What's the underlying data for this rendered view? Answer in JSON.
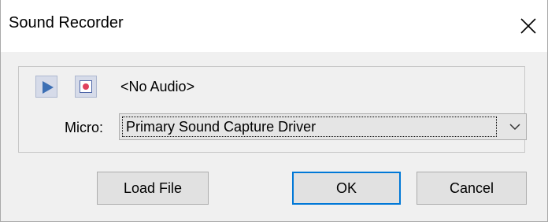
{
  "window": {
    "title": "Sound Recorder",
    "close_icon": "close-icon"
  },
  "recorder": {
    "play_icon": "play-icon",
    "record_icon": "record-icon",
    "status": "<No Audio>",
    "micro_label": "Micro:",
    "micro_selected": "Primary Sound Capture Driver",
    "dropdown_icon": "chevron-down-icon"
  },
  "buttons": {
    "load_file": "Load File",
    "ok": "OK",
    "cancel": "Cancel"
  },
  "colors": {
    "accent": "#0078d7",
    "play_blue": "#3c6fb4",
    "record_red": "#e0415d"
  }
}
